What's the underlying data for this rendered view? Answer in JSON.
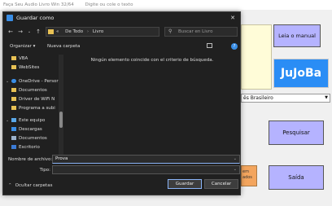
{
  "background": {
    "title_items": [
      "Faça Seu Audio Livro Win 32/64",
      "Digite ou cole o texto"
    ],
    "manual_button": "Leia o manual",
    "logo_text": "JuJoBa",
    "language_value": "ês Brasileiro",
    "search_button": "Pesquisar",
    "orange_button": "em\nados",
    "exit_button": "Saída",
    "colors": {
      "accent_button": "#b5b3ff",
      "logo_bg": "#2a8df5"
    }
  },
  "dialog": {
    "title": "Guardar como",
    "address": {
      "prefix": "«",
      "parts": [
        "De Todo",
        "Livro"
      ]
    },
    "search_placeholder": "Buscar en Livro",
    "toolbar": {
      "organize": "Organizar ▾",
      "new_folder": "Nueva carpeta"
    },
    "sidebar": {
      "items": [
        {
          "label": "VBA",
          "icon": "folder-icon"
        },
        {
          "label": "WebSites",
          "icon": "folder-icon"
        },
        {
          "label": "OneDrive - Persor",
          "icon": "cloud-icon"
        },
        {
          "label": "Documentos",
          "icon": "folder-icon"
        },
        {
          "label": "Driver de WiFi N",
          "icon": "folder-icon"
        },
        {
          "label": "Programa a subi",
          "icon": "folder-icon"
        },
        {
          "label": "Este equipo",
          "icon": "computer-icon"
        },
        {
          "label": "Descargas",
          "icon": "download-icon"
        },
        {
          "label": "Documentos",
          "icon": "documents-icon"
        },
        {
          "label": "Escritorio",
          "icon": "desktop-icon"
        }
      ]
    },
    "empty_message": "Ningún elemento coincide con el criterio de búsqueda.",
    "filename_label": "Nombre de archivo:",
    "filename_value": "Prova",
    "type_label": "Tipo:",
    "type_value": "",
    "hide_folders": "Ocultar carpetas",
    "save_button": "Guardar",
    "cancel_button": "Cancelar"
  }
}
